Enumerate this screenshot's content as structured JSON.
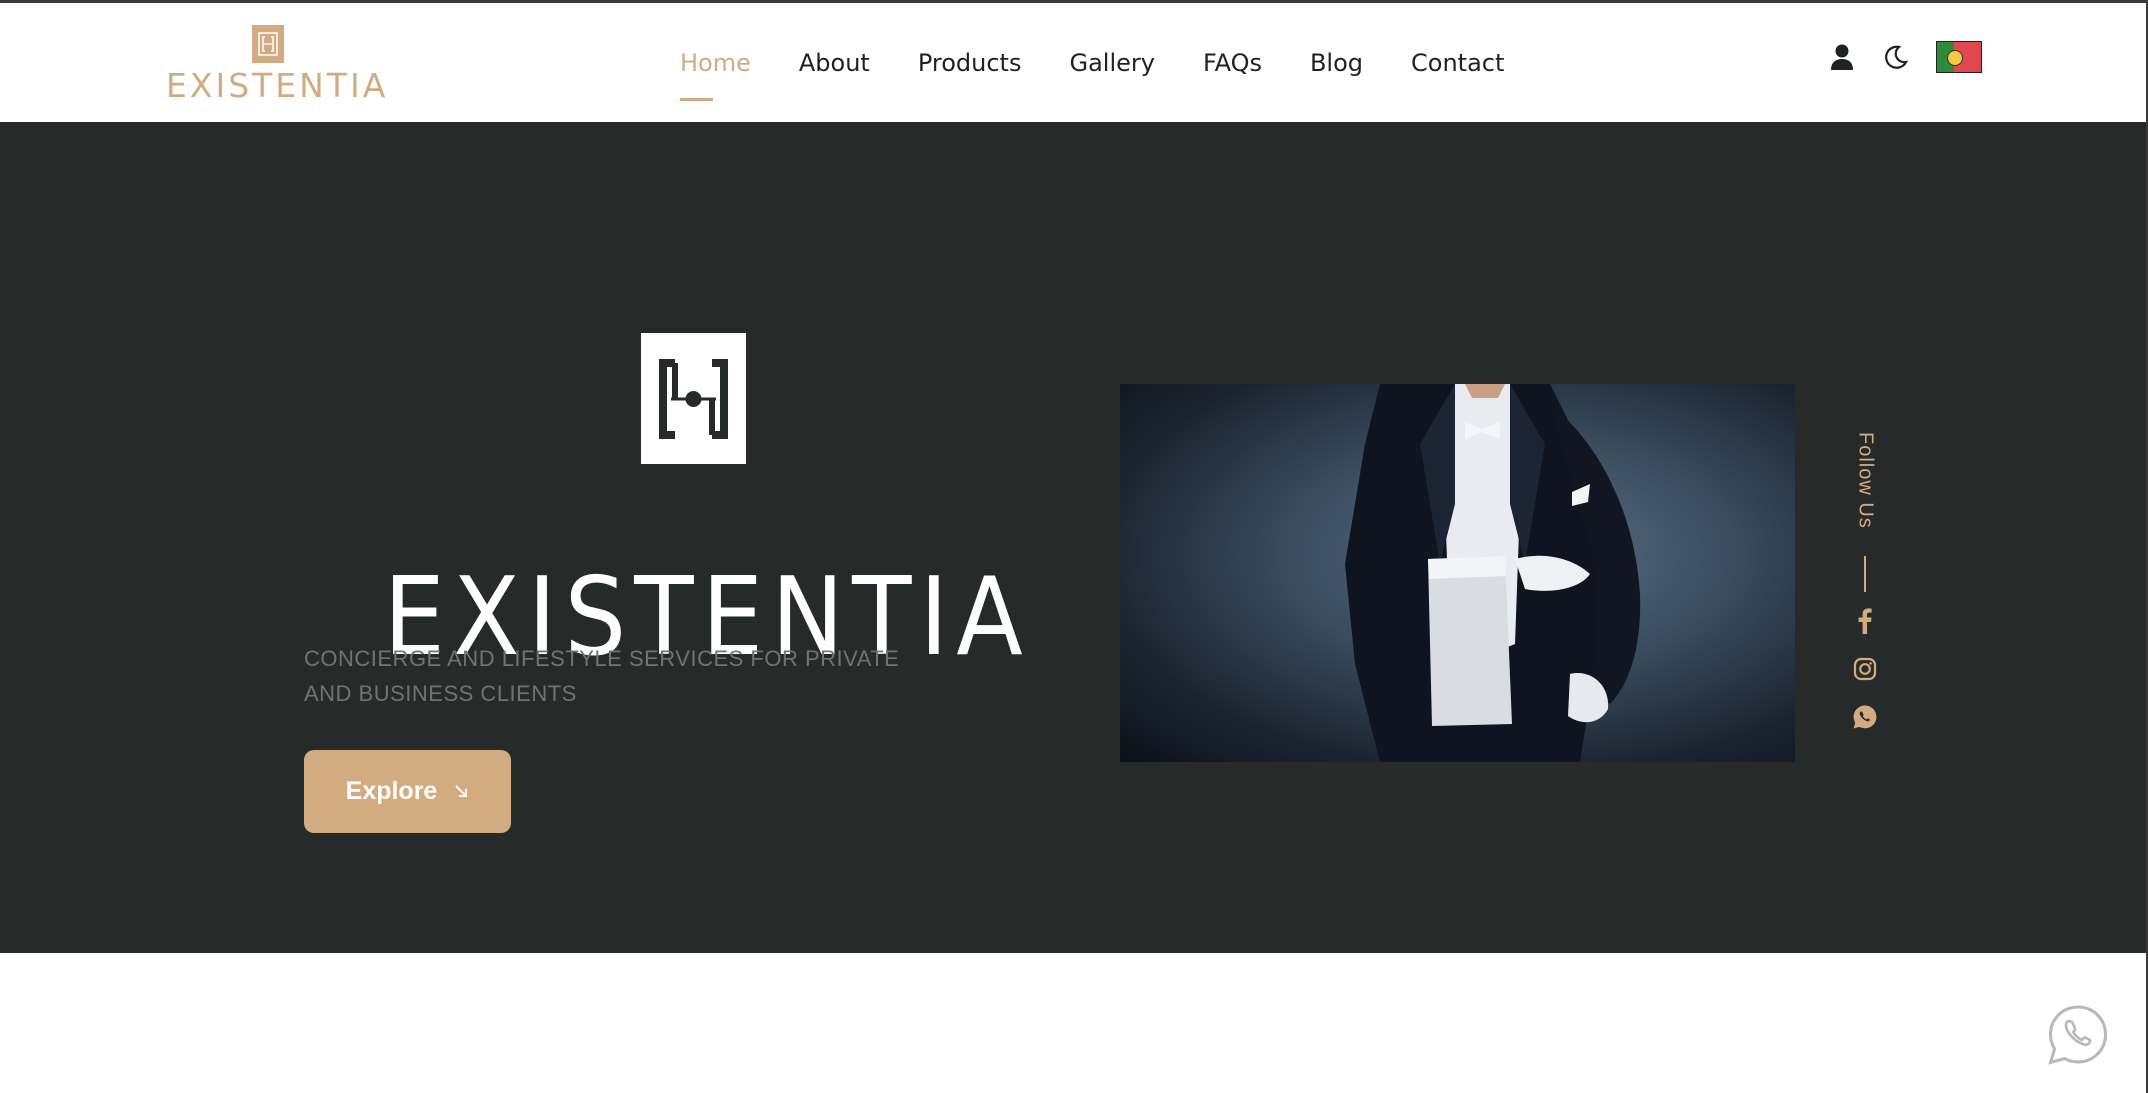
{
  "brand": {
    "logo_text": "EXISTENTIA",
    "accent_color": "#d3ab80",
    "dark_bg": "#262a29"
  },
  "nav": {
    "items": [
      {
        "label": "Home",
        "active": true
      },
      {
        "label": "About",
        "active": false
      },
      {
        "label": "Products",
        "active": false
      },
      {
        "label": "Gallery",
        "active": false
      },
      {
        "label": "FAQs",
        "active": false
      },
      {
        "label": "Blog",
        "active": false
      },
      {
        "label": "Contact",
        "active": false
      }
    ]
  },
  "header_icons": [
    "user-icon",
    "moon-icon",
    "portugal-flag-icon"
  ],
  "hero": {
    "title": "EXISTENTIA",
    "subtitle": "CONCIERGE AND LIFESTYLE SERVICES FOR PRIVATE AND BUSINESS CLIENTS",
    "cta_label": "Explore",
    "cta_icon": "arrow-down-right-icon"
  },
  "follow": {
    "label": "Follow Us",
    "socials": [
      "facebook-icon",
      "instagram-icon",
      "whatsapp-icon"
    ]
  },
  "floating": {
    "icon": "whatsapp-chat-icon"
  }
}
